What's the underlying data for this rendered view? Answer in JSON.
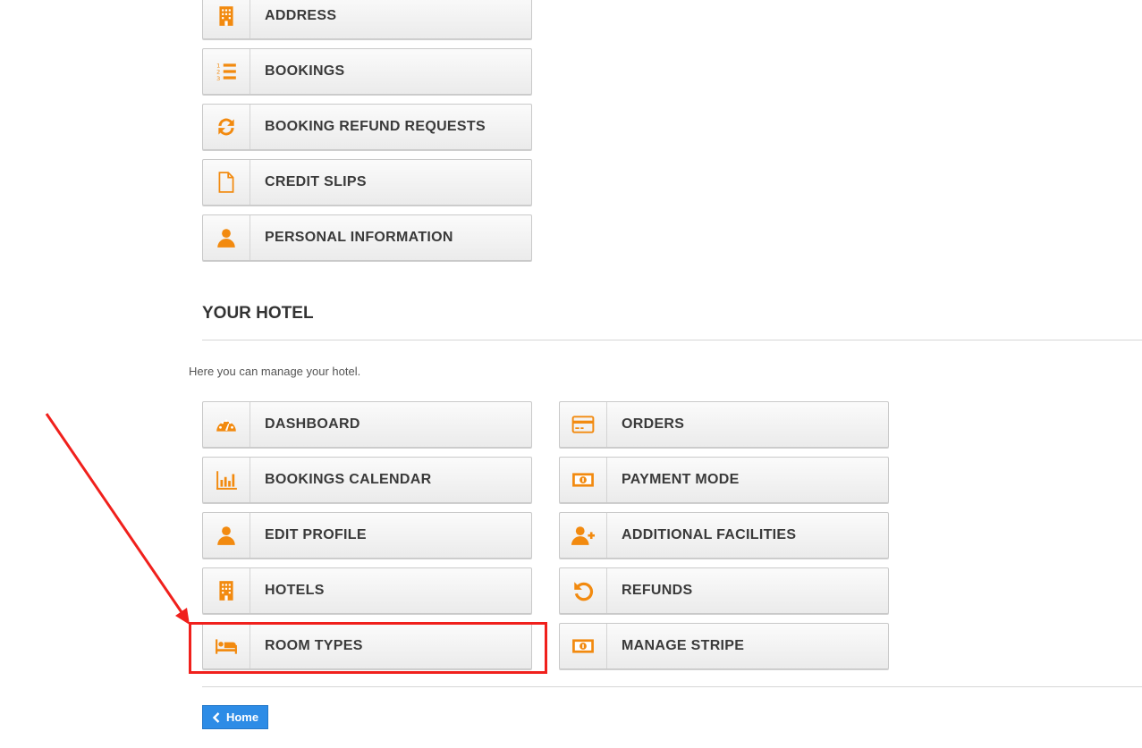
{
  "account_menu": {
    "items": [
      {
        "label": "ADDRESS",
        "icon": "building-icon"
      },
      {
        "label": "BOOKINGS",
        "icon": "numbered-list-icon"
      },
      {
        "label": "BOOKING REFUND REQUESTS",
        "icon": "refresh-icon"
      },
      {
        "label": "CREDIT SLIPS",
        "icon": "file-icon"
      },
      {
        "label": "PERSONAL INFORMATION",
        "icon": "user-icon"
      }
    ]
  },
  "hotel_section": {
    "title": "YOUR HOTEL",
    "description": "Here you can manage your hotel.",
    "left_items": [
      {
        "label": "DASHBOARD",
        "icon": "dashboard-icon"
      },
      {
        "label": "BOOKINGS CALENDAR",
        "icon": "bar-chart-icon"
      },
      {
        "label": "EDIT PROFILE",
        "icon": "user-icon"
      },
      {
        "label": "HOTELS",
        "icon": "building-icon"
      },
      {
        "label": "ROOM TYPES",
        "icon": "bed-icon"
      }
    ],
    "right_items": [
      {
        "label": "ORDERS",
        "icon": "credit-card-icon"
      },
      {
        "label": "PAYMENT MODE",
        "icon": "money-icon"
      },
      {
        "label": "ADDITIONAL FACILITIES",
        "icon": "user-plus-icon"
      },
      {
        "label": "REFUNDS",
        "icon": "undo-icon"
      },
      {
        "label": "MANAGE STRIPE",
        "icon": "money-icon"
      }
    ]
  },
  "footer": {
    "home_label": "Home"
  },
  "colors": {
    "icon_accent": "#f28a0f",
    "home_button": "#2d8ce6",
    "annotation": "#f0201c"
  }
}
